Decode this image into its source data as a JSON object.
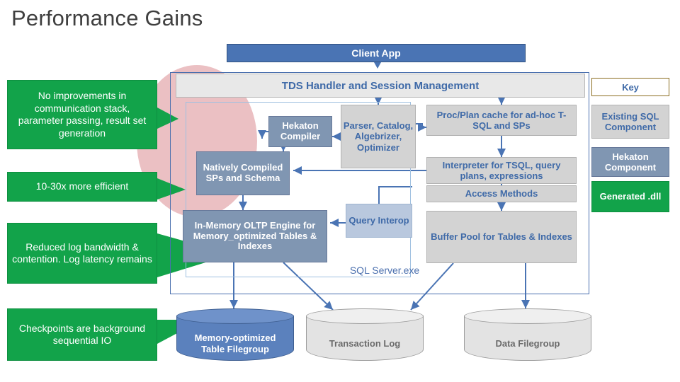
{
  "page": {
    "title": "Performance Gains"
  },
  "diagram": {
    "client_app": "Client App",
    "tds_handler": "TDS Handler and Session Management",
    "hekaton_compiler": "Hekaton\nCompiler",
    "natively_compiled": "Natively Compiled SPs and Schema",
    "in_memory_engine": "In-Memory OLTP Engine for Memory_optimized Tables & Indexes",
    "parser": "Parser, Catalog, Algebrizer, Optimizer",
    "proc_plan_cache": "Proc/Plan cache for ad-hoc T-SQL and SPs",
    "interpreter": "Interpreter for TSQL, query plans, expressions",
    "access_methods": "Access Methods",
    "buffer_pool": "Buffer Pool for Tables & Indexes",
    "query_interop": "Query Interop",
    "exe_label": "SQL Server.exe"
  },
  "storage": [
    {
      "label": "Memory-optimized Table Filegroup",
      "style": "blue"
    },
    {
      "label": "Transaction Log",
      "style": "gray"
    },
    {
      "label": "Data Filegroup",
      "style": "gray"
    }
  ],
  "callouts": [
    {
      "text": "No improvements in communication stack, parameter passing, result set generation"
    },
    {
      "text": "10-30x more efficient"
    },
    {
      "text": "Reduced log bandwidth & contention. Log latency remains"
    },
    {
      "text": "Checkpoints are background sequential IO"
    }
  ],
  "key": {
    "title": "Key",
    "items": [
      {
        "label": "Existing SQL Component",
        "color": "#d3d3d3"
      },
      {
        "label": "Hekaton Component",
        "color": "#8096b2"
      },
      {
        "label": "Generated .dll",
        "color": "#12a34a"
      }
    ]
  },
  "colors": {
    "green_callout": "#12a34a",
    "hekaton_blue_gray": "#8096b2",
    "sql_gray": "#d3d3d3",
    "client_blue": "#4a74b4",
    "text_blue": "#3f6aa8",
    "pink_blob": "#e8b5b8"
  }
}
